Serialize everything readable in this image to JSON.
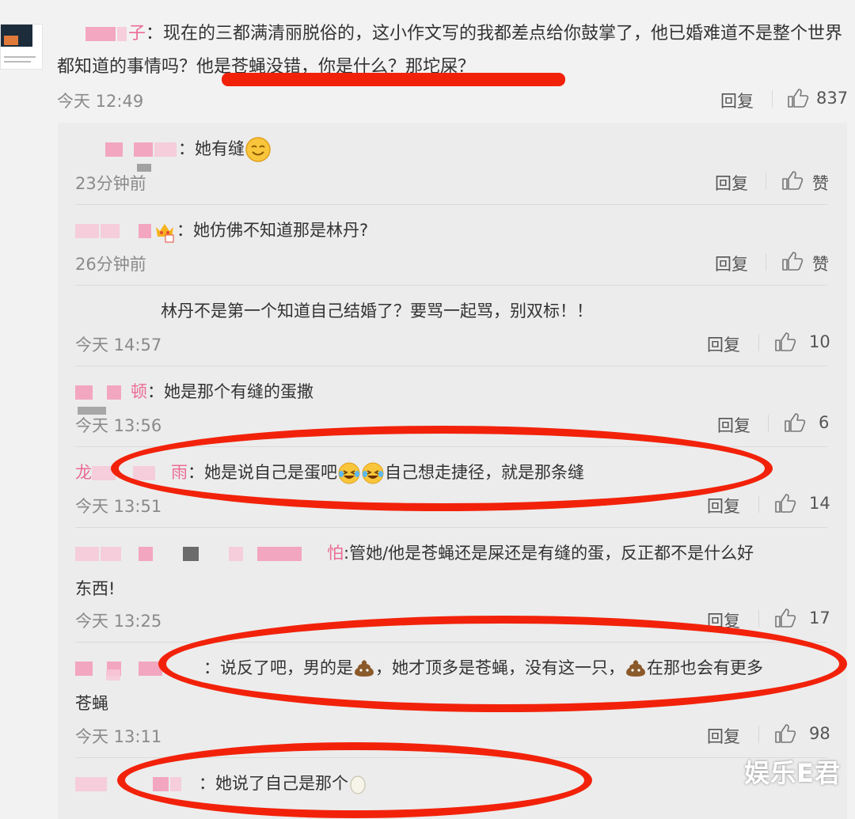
{
  "main_comment": {
    "user_suffix": "子",
    "text": "：现在的三都满清丽脱俗的，这小作文写的我都差点给你鼓掌了，他已婚难道不是整个世界都知道的事情吗？他是苍蝇没错，你是什么？那坨屎？",
    "time": "今天 12:49",
    "reply_label": "回复",
    "likes": "837"
  },
  "replies": [
    {
      "user_suffix": "",
      "text": "：她有缝",
      "time": "23分钟前",
      "reply_label": "回复",
      "likes": "赞"
    },
    {
      "user_suffix": "",
      "text": "：她仿佛不知道那是林丹?",
      "time": "26分钟前",
      "reply_label": "回复",
      "likes": "赞"
    },
    {
      "user_suffix": "",
      "text": "林丹不是第一个知道自己结婚了？要骂一起骂，别双标！！",
      "time": "今天 14:57",
      "reply_label": "回复",
      "likes": "10"
    },
    {
      "user_suffix": "顿",
      "text": "：她是那个有缝的蛋撒",
      "time": "今天 13:56",
      "reply_label": "回复",
      "likes": "6"
    },
    {
      "user_prefix": "龙",
      "user_suffix": "雨",
      "text_a": "：她是说自己是蛋吧",
      "text_b": "自己想走捷径，就是那条缝",
      "time": "今天 13:51",
      "reply_label": "回复",
      "likes": "14"
    },
    {
      "user_suffix": "怕",
      "text_line1": ":管她/他是苍蝇还是屎还是有缝的蛋，反正都不是什么好",
      "text_line2": "东西!",
      "time": "今天 13:25",
      "reply_label": "回复",
      "likes": "17"
    },
    {
      "user_suffix": "",
      "text_a": "：说反了吧，男的是",
      "text_b": "，她才顶多是苍蝇，没有这一只，",
      "text_c": "在那也会有更多",
      "text_line2": "苍蝇",
      "time": "今天 13:11",
      "reply_label": "回复",
      "likes": "98"
    },
    {
      "user_suffix": "",
      "text_a": "：她说了自己是那个",
      "time": "",
      "reply_label": "",
      "likes": ""
    }
  ],
  "watermark": "娱乐E君",
  "colors": {
    "annotation_red": "#f2220a",
    "username_pink": "#eb6b94",
    "background": "#f2f2f2",
    "panel": "#ececec"
  }
}
